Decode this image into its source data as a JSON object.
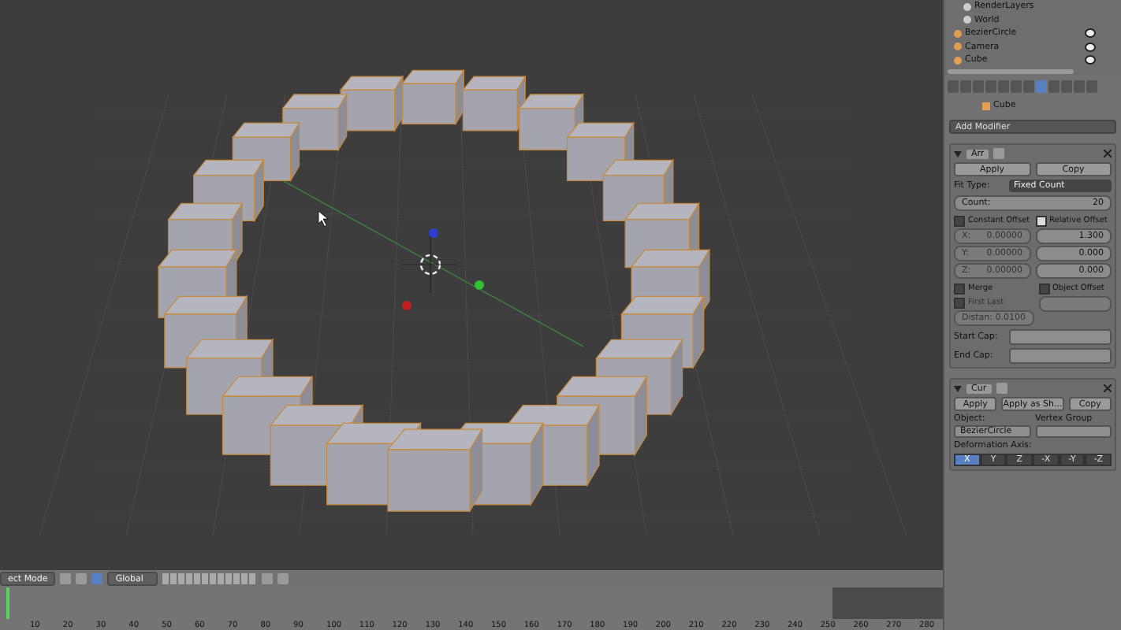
{
  "viewport": {
    "header": {
      "mode": "ect Mode",
      "orientation": "Global"
    }
  },
  "timeline": {
    "frames": [
      "10",
      "20",
      "30",
      "40",
      "50",
      "60",
      "70",
      "80",
      "90",
      "100",
      "110",
      "120",
      "130",
      "140",
      "150",
      "160",
      "170",
      "180",
      "190",
      "200",
      "210",
      "220",
      "230",
      "240",
      "250",
      "260",
      "270",
      "280"
    ]
  },
  "outliner": {
    "items": [
      {
        "label": "RenderLayers",
        "kind": "layer"
      },
      {
        "label": "World",
        "kind": "world"
      },
      {
        "label": "BezierCircle",
        "kind": "object"
      },
      {
        "label": "Camera",
        "kind": "object"
      },
      {
        "label": "Cube",
        "kind": "object"
      }
    ]
  },
  "properties": {
    "tabs": [
      {
        "selected": false
      },
      {
        "selected": false
      },
      {
        "selected": false
      },
      {
        "selected": false
      },
      {
        "selected": false
      },
      {
        "selected": false
      },
      {
        "selected": false
      },
      {
        "selected": true
      },
      {
        "selected": false
      },
      {
        "selected": false
      },
      {
        "selected": false
      },
      {
        "selected": false
      }
    ],
    "object_name": "Cube",
    "add_modifier": "Add Modifier",
    "array": {
      "name": "Arr",
      "buttons": [
        "Apply",
        "Copy"
      ],
      "fit_type_label": "Fit Type:",
      "fit_type": "Fixed Count",
      "count_label": "Count:",
      "count": "20",
      "constant_offset": {
        "label": "Constant Offset",
        "checked": false
      },
      "relative_offset": {
        "label": "Relative Offset",
        "checked": true
      },
      "constant_values": [
        {
          "axis": "X:",
          "value": "0.00000"
        },
        {
          "axis": "Y:",
          "value": "0.00000"
        },
        {
          "axis": "Z:",
          "value": "0.00000"
        }
      ],
      "relative_values": [
        "1.300",
        "0.000",
        "0.000"
      ],
      "merge": {
        "label": "Merge",
        "checked": false
      },
      "object_offset": {
        "label": "Object Offset",
        "checked": false
      },
      "first_last": {
        "label": "First Last",
        "checked": false
      },
      "distance": "Distan: 0.0100",
      "start_cap": "Start Cap:",
      "end_cap": "End Cap:"
    },
    "curve": {
      "name": "Cur",
      "buttons": [
        "Apply",
        "Apply as Sh...",
        "Copy"
      ],
      "object_label": "Object:",
      "object": "BezierCircle",
      "vertex_group_label": "Vertex Group",
      "axis_label": "Deformation Axis:",
      "axes": [
        {
          "label": "X",
          "selected": true
        },
        {
          "label": "Y",
          "selected": false
        },
        {
          "label": "Z",
          "selected": false
        },
        {
          "label": "-X",
          "selected": false
        },
        {
          "label": "-Y",
          "selected": false
        },
        {
          "label": "-Z",
          "selected": false
        }
      ]
    }
  }
}
